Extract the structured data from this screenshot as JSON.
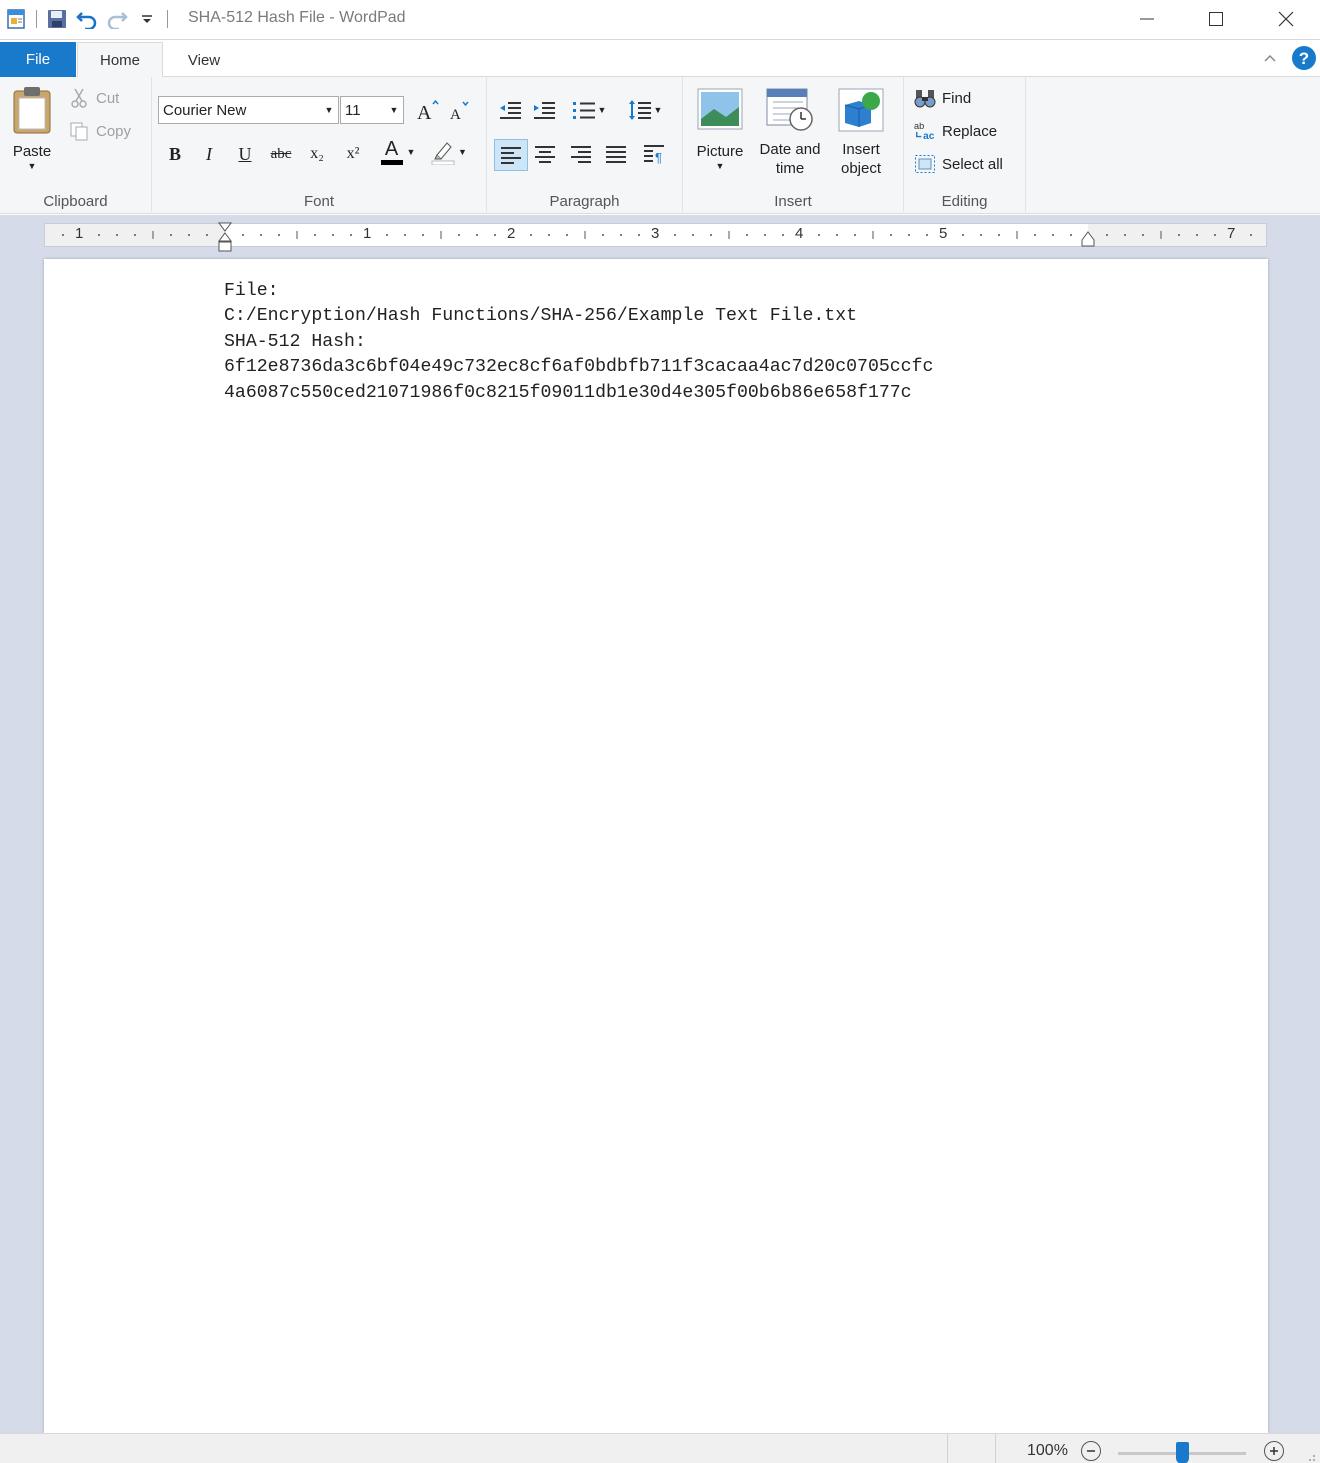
{
  "window": {
    "title": "SHA-512 Hash File - WordPad"
  },
  "qat": {
    "icons": [
      "wordpad-icon",
      "save-icon",
      "undo-icon",
      "redo-icon",
      "customize-qat-icon"
    ]
  },
  "tabs": {
    "file": "File",
    "home": "Home",
    "view": "View"
  },
  "ribbon": {
    "clipboard": {
      "label": "Clipboard",
      "paste": "Paste",
      "cut": "Cut",
      "copy": "Copy"
    },
    "font": {
      "label": "Font",
      "family": "Courier New",
      "size": "11",
      "bold": "B",
      "italic": "I",
      "underline": "U",
      "strike": "abc",
      "subscript": "x₂",
      "superscript": "x²",
      "color_letter": "A"
    },
    "paragraph": {
      "label": "Paragraph"
    },
    "insert": {
      "label": "Insert",
      "picture": "Picture",
      "datetime_1": "Date and",
      "datetime_2": "time",
      "object_1": "Insert",
      "object_2": "object"
    },
    "editing": {
      "label": "Editing",
      "find": "Find",
      "replace": "Replace",
      "select_all": "Select all"
    }
  },
  "ruler": {
    "numbers": [
      "1",
      "1",
      "2",
      "3",
      "4",
      "5",
      "7"
    ]
  },
  "document": {
    "lines": [
      "File:",
      "C:/Encryption/Hash Functions/SHA-256/Example Text File.txt",
      "SHA-512 Hash:",
      "6f12e8736da3c6bf04e49c732ec8cf6af0bdbfb711f3cacaa4ac7d20c0705ccfc",
      "4a6087c550ced21071986f0c8215f09011db1e30d4e305f00b6b86e658f177c"
    ]
  },
  "status": {
    "zoom": "100%",
    "zoom_level": 0.5
  },
  "colors": {
    "accent": "#1979ca",
    "ribbon_bg": "#f5f6f7",
    "workspace_bg": "#d6dbe9"
  }
}
